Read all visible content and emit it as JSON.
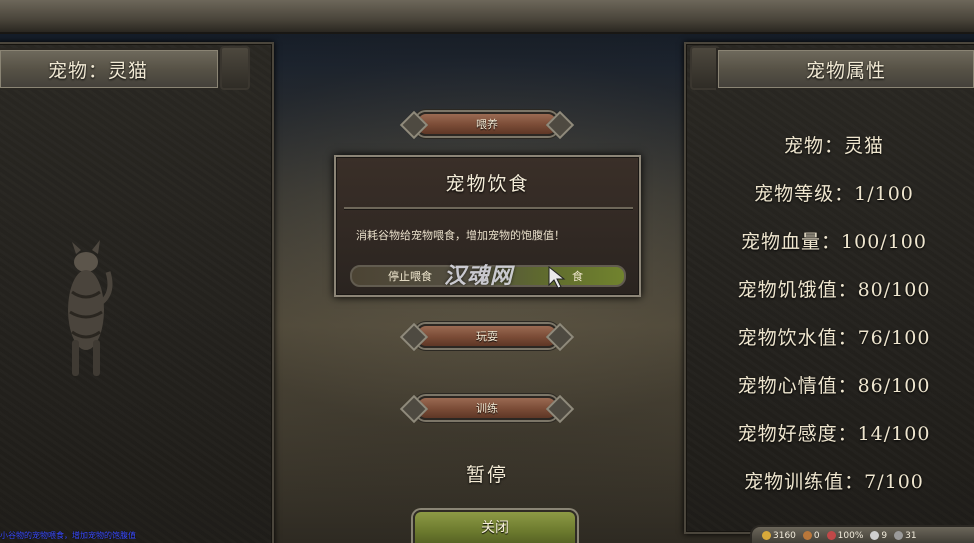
{
  "left_panel": {
    "title": "宠物：灵猫"
  },
  "right_panel": {
    "title": "宠物属性",
    "stats": [
      "宠物：灵猫",
      "宠物等级：1/100",
      "宠物血量：100/100",
      "宠物饥饿值：80/100",
      "宠物饮水值：76/100",
      "宠物心情值：86/100",
      "宠物好感度：14/100",
      "宠物训练值：7/100"
    ]
  },
  "center": {
    "feed_label": "喂养",
    "play_label": "玩耍",
    "train_label": "训练",
    "pause_label": "暂停",
    "close_label": "关闭"
  },
  "dialog": {
    "title": "宠物饮食",
    "description": "消耗谷物给宠物喂食，增加宠物的饱腹值！",
    "stop_feed_label": "停止喂食",
    "feed_partial_label": "食"
  },
  "watermark": "汉魂网",
  "message_log": "小谷物的宠物喂食，增加宠物的饱腹值",
  "status_bar": {
    "gold": "3160",
    "food": "0",
    "health": "100%",
    "troops": "9",
    "extra": "31"
  },
  "colors": {
    "panel_bg": "#24221e",
    "header_bg": "#575246",
    "button_brown": "#7a4b36",
    "button_green": "#6c7a2e",
    "message_blue": "#3b4cff"
  }
}
